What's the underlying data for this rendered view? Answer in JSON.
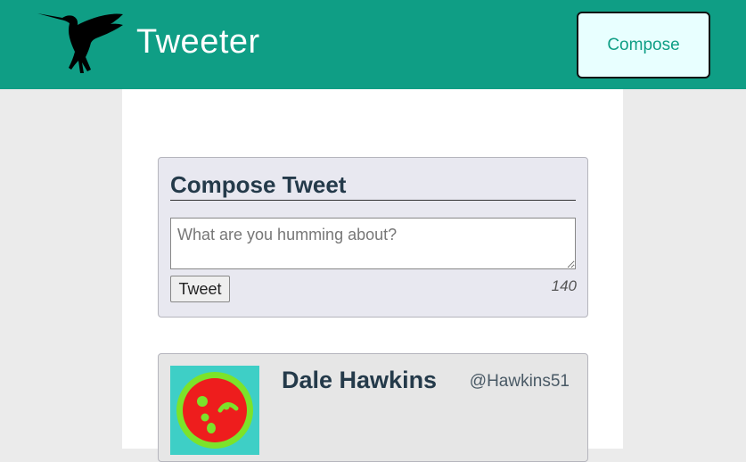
{
  "header": {
    "logo_icon": "hummingbird-icon",
    "title": "Tweeter",
    "compose_label": "Compose"
  },
  "compose": {
    "heading": "Compose Tweet",
    "placeholder": "What are you humming about?",
    "tweet_button_label": "Tweet",
    "char_count": "140"
  },
  "tweets": [
    {
      "author_name": "Dale Hawkins",
      "handle": "@Hawkins51",
      "avatar_icon": "avatar-face-icon"
    }
  ],
  "colors": {
    "brand": "#0f9e85",
    "page_bg": "#ebebeb",
    "panel_bg": "#e8e8f0",
    "heading_text": "#243a4a"
  }
}
